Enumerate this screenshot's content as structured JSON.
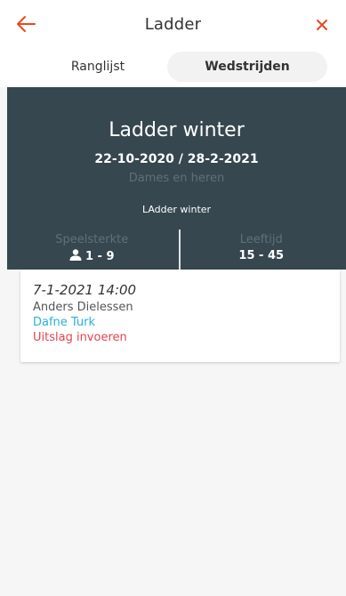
{
  "header": {
    "title": "Ladder",
    "back_icon": "arrow-left-icon",
    "close_icon": "close-icon",
    "accent_color": "#e8481d"
  },
  "tabs": [
    {
      "label": "Ranglijst",
      "active": false
    },
    {
      "label": "Wedstrijden",
      "active": true
    }
  ],
  "competition": {
    "name": "Ladder winter",
    "dates": "22-10-2020 / 28-2-2021",
    "category": "Dames en heren",
    "description": "LAdder winter",
    "stats": {
      "strength_label": "Speelsterkte",
      "strength_value": "1 - 9",
      "strength_icon": "user-icon",
      "age_label": "Leeftijd",
      "age_value": "15 - 45"
    }
  },
  "match": {
    "datetime": "7-1-2021 14:00",
    "player1": "Anders Dielessen",
    "player2": "Dafne Turk",
    "action": "Uitslag invoeren"
  }
}
